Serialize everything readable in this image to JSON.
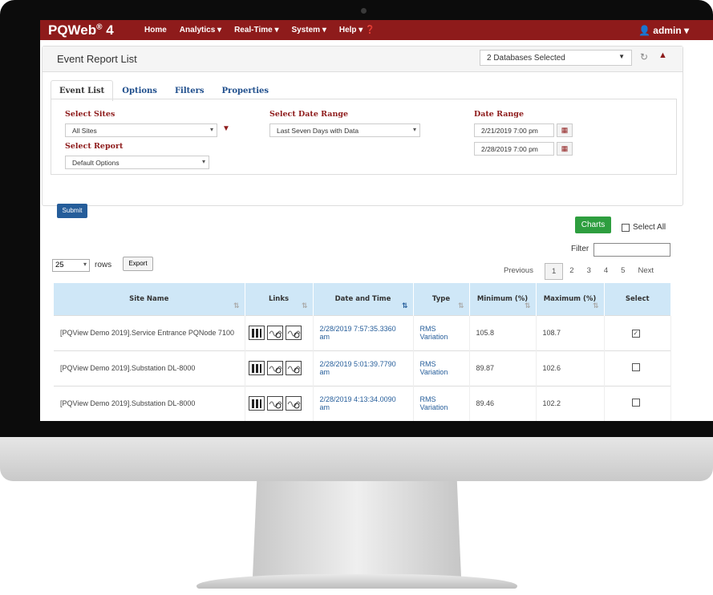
{
  "app": {
    "brand": "PQWeb",
    "brand_mark": "®",
    "brand_version": "4"
  },
  "navbar": {
    "items": [
      "Home",
      "Analytics ▾",
      "Real-Time ▾",
      "System ▾",
      "Help ▾ ❓"
    ],
    "user": "admin ▾"
  },
  "panel": {
    "title": "Event Report List",
    "db_selected": "2 Databases Selected"
  },
  "tabs": [
    "Event List",
    "Options",
    "Filters",
    "Properties"
  ],
  "form": {
    "sites_label": "Select Sites",
    "sites_value": "All Sites",
    "report_label": "Select Report",
    "report_value": "Default Options",
    "date_range_select_label": "Select Date Range",
    "date_range_select_value": "Last Seven Days with Data",
    "date_range_label": "Date Range",
    "date_start": "2/21/2019 7:00 pm",
    "date_end": "2/28/2019 7:00 pm",
    "submit": "Submit"
  },
  "toolbar": {
    "charts": "Charts",
    "select_all": "Select All",
    "filter": "Filter",
    "rows_value": "25",
    "rows_label": "rows",
    "export": "Export"
  },
  "pager": {
    "previous": "Previous",
    "pages": [
      "1",
      "2",
      "3",
      "4",
      "5"
    ],
    "active_page": "1",
    "next": "Next"
  },
  "table": {
    "headers": {
      "site": "Site Name",
      "links": "Links",
      "date": "Date and Time",
      "type": "Type",
      "min": "Minimum (%)",
      "max": "Maximum (%)",
      "select": "Select"
    },
    "rows": [
      {
        "site": "[PQView Demo 2019].Service Entrance PQNode 7100",
        "date": "2/28/2019 7:57:35.3360 am",
        "type": "RMS Variation",
        "min": "105.8",
        "max": "108.7",
        "checked": true
      },
      {
        "site": "[PQView Demo 2019].Substation DL-8000",
        "date": "2/28/2019 5:01:39.7790 am",
        "type": "RMS Variation",
        "min": "89.87",
        "max": "102.6",
        "checked": false
      },
      {
        "site": "[PQView Demo 2019].Substation DL-8000",
        "date": "2/28/2019 4:13:34.0090 am",
        "type": "RMS Variation",
        "min": "89.46",
        "max": "102.2",
        "checked": false
      }
    ]
  },
  "colors": {
    "brand_red": "#8e1b1b",
    "table_header": "#cfe7f7",
    "charts_green": "#2e9e3f",
    "link_blue": "#255d9a"
  }
}
